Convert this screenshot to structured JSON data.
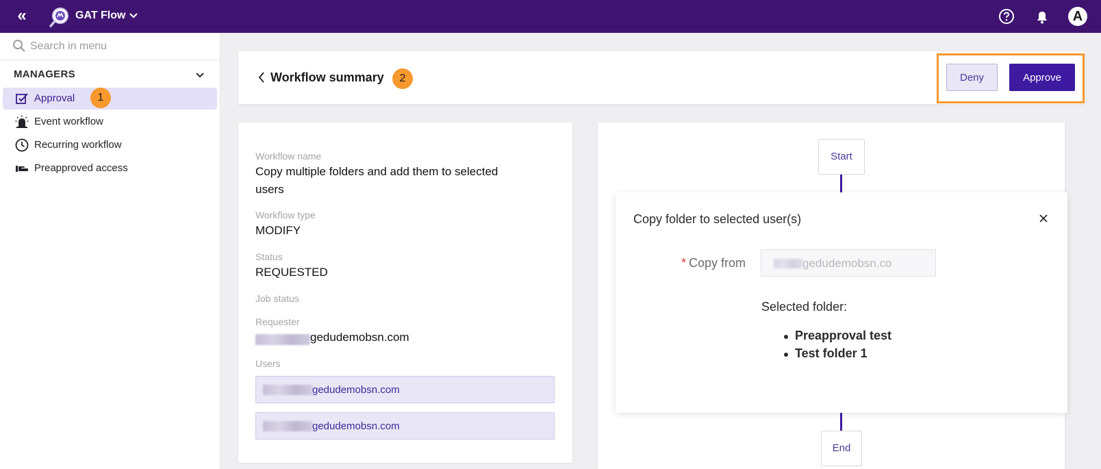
{
  "topbar": {
    "app_name": "GAT Flow",
    "collapse_icon": "double-chevron-left-icon",
    "avatar_letter": "A"
  },
  "sidebar": {
    "search_placeholder": "Search in menu",
    "section_title": "MANAGERS",
    "items": [
      {
        "label": "Approval",
        "icon": "approval-check-icon",
        "active": true
      },
      {
        "label": "Event workflow",
        "icon": "alarm-icon",
        "active": false
      },
      {
        "label": "Recurring workflow",
        "icon": "clock-icon",
        "active": false
      },
      {
        "label": "Preapproved access",
        "icon": "hand-icon",
        "active": false
      }
    ],
    "badge": "1"
  },
  "header": {
    "title": "Workflow summary",
    "badge": "2",
    "deny_label": "Deny",
    "approve_label": "Approve"
  },
  "details": {
    "workflow_name_label": "Workflow name",
    "workflow_name_line1": "Copy multiple folders and add them to selected",
    "workflow_name_line2": "users",
    "workflow_type_label": "Workflow type",
    "workflow_type": "MODIFY",
    "status_label": "Status",
    "status": "REQUESTED",
    "job_status_label": "Job status",
    "requester_label": "Requester",
    "requester": "gedudemobsn.com",
    "users_label": "Users",
    "users": [
      "gedudemobsn.com",
      "gedudemobsn.com"
    ]
  },
  "flow": {
    "start_label": "Start",
    "end_label": "End",
    "panel_title": "Copy folder to selected user(s)",
    "copy_from_required": "*",
    "copy_from_label": "Copy from",
    "copy_from_value": "gedudemobsn.co",
    "selected_folder_label": "Selected folder:",
    "folders": [
      "Preapproval test",
      "Test folder 1"
    ]
  },
  "colors": {
    "topbar": "#3e1470",
    "accent": "#3d1aa0",
    "highlight": "#f7992e",
    "active_item_bg": "#e4e0f7"
  }
}
